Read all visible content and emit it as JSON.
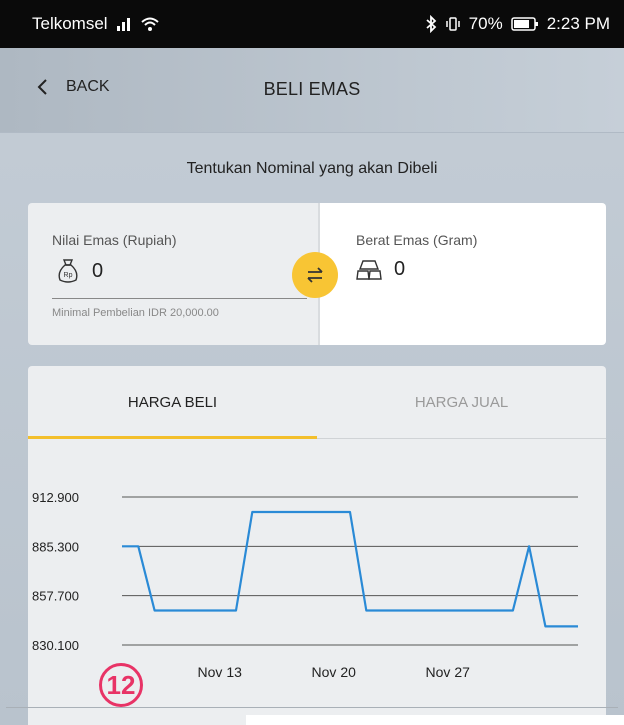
{
  "status_bar": {
    "carrier": "Telkomsel",
    "battery": "70%",
    "time": "2:23 PM"
  },
  "nav": {
    "back_label": "BACK",
    "title": "BELI EMAS"
  },
  "instruction": "Tentukan Nominal yang akan Dibeli",
  "input_card": {
    "rupiah_label": "Nilai Emas (Rupiah)",
    "rupiah_value": "0",
    "rupiah_min_note": "Minimal Pembelian IDR 20,000.00",
    "gram_label": "Berat Emas (Gram)",
    "gram_value": "0",
    "rupiah_icon_text": "Rp"
  },
  "tabs": [
    {
      "label": "HARGA BELI",
      "active": true
    },
    {
      "label": "HARGA JUAL",
      "active": false
    }
  ],
  "chart_data": {
    "type": "line",
    "x_tick_labels": [
      "Nov 13",
      "Nov 20",
      "Nov 27"
    ],
    "y_ticks": [
      912900,
      885300,
      857700,
      830100
    ],
    "y_tick_labels": [
      "912.900",
      "885.300",
      "857.700",
      "830.100"
    ],
    "ylim": [
      830100,
      912900
    ],
    "color": "#2a8ad6",
    "series": [
      {
        "points": [
          [
            "Nov 7",
            885300
          ],
          [
            "Nov 8",
            885300
          ],
          [
            "Nov 9",
            849400
          ],
          [
            "Nov 14",
            849400
          ],
          [
            "Nov 15",
            904500
          ],
          [
            "Nov 21",
            904500
          ],
          [
            "Nov 22",
            849400
          ],
          [
            "Dec 1",
            849400
          ],
          [
            "Dec 2",
            885300
          ],
          [
            "Dec 3",
            840500
          ],
          [
            "Dec 5",
            840500
          ]
        ]
      }
    ]
  },
  "step_badge": "12"
}
